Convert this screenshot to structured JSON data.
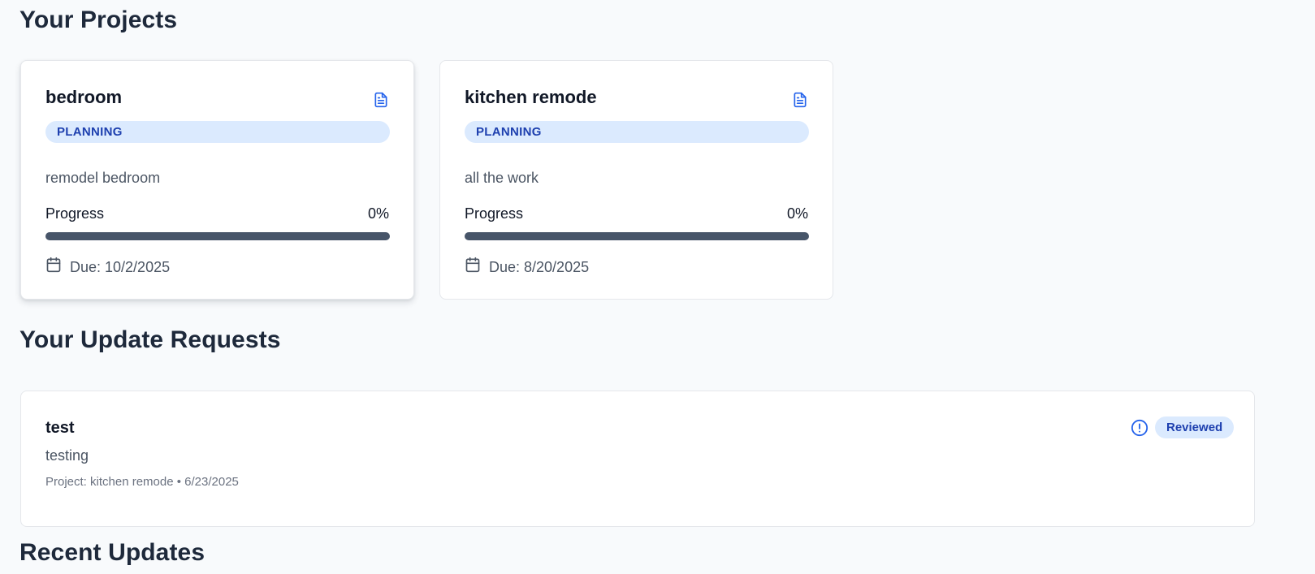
{
  "projects_section": {
    "title": "Your Projects",
    "projects": [
      {
        "name": "bedroom",
        "status": "PLANNING",
        "description": "remodel bedroom",
        "progress_label": "Progress",
        "progress_text": "0%",
        "progress_fraction": 0,
        "due": "Due: 10/2/2025",
        "icon": "document-icon"
      },
      {
        "name": "kitchen remode",
        "status": "PLANNING",
        "description": "all the work",
        "progress_label": "Progress",
        "progress_text": "0%",
        "progress_fraction": 0,
        "due": "Due: 8/20/2025",
        "icon": "document-icon"
      }
    ]
  },
  "requests_section": {
    "title": "Your Update Requests",
    "requests": [
      {
        "title": "test",
        "description": "testing",
        "meta": "Project: kitchen remode • 6/23/2025",
        "status": "Reviewed",
        "status_icon": "alert-circle-icon"
      }
    ]
  },
  "recent_section": {
    "title": "Recent Updates"
  },
  "colors": {
    "background": "#f8fafc",
    "accent": "#2563eb",
    "badge_bg": "#dbeafe",
    "badge_text": "#1e40af",
    "progress_track": "#475569"
  }
}
